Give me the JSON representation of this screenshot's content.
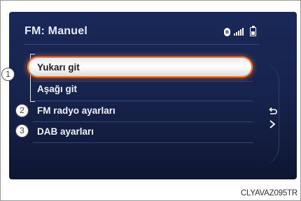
{
  "header": {
    "title": "FM: Manuel",
    "status_icons": [
      "bluetooth-icon",
      "signal-icon",
      "battery-icon"
    ]
  },
  "menu": {
    "items": [
      {
        "label": "Yukarı git",
        "selected": true
      },
      {
        "label": "Aşağı git",
        "selected": false
      },
      {
        "label": "FM radyo ayarları",
        "selected": false
      },
      {
        "label": "DAB ayarları",
        "selected": false
      }
    ],
    "back_icon": "back-arrow-icon"
  },
  "callouts": [
    "1",
    "2",
    "3"
  ],
  "credit": "CLYAVAZ095TR",
  "colors": {
    "screen_bg": "#17244e",
    "selection_glow": "#f27b3a",
    "text": "#f1f3f8"
  }
}
